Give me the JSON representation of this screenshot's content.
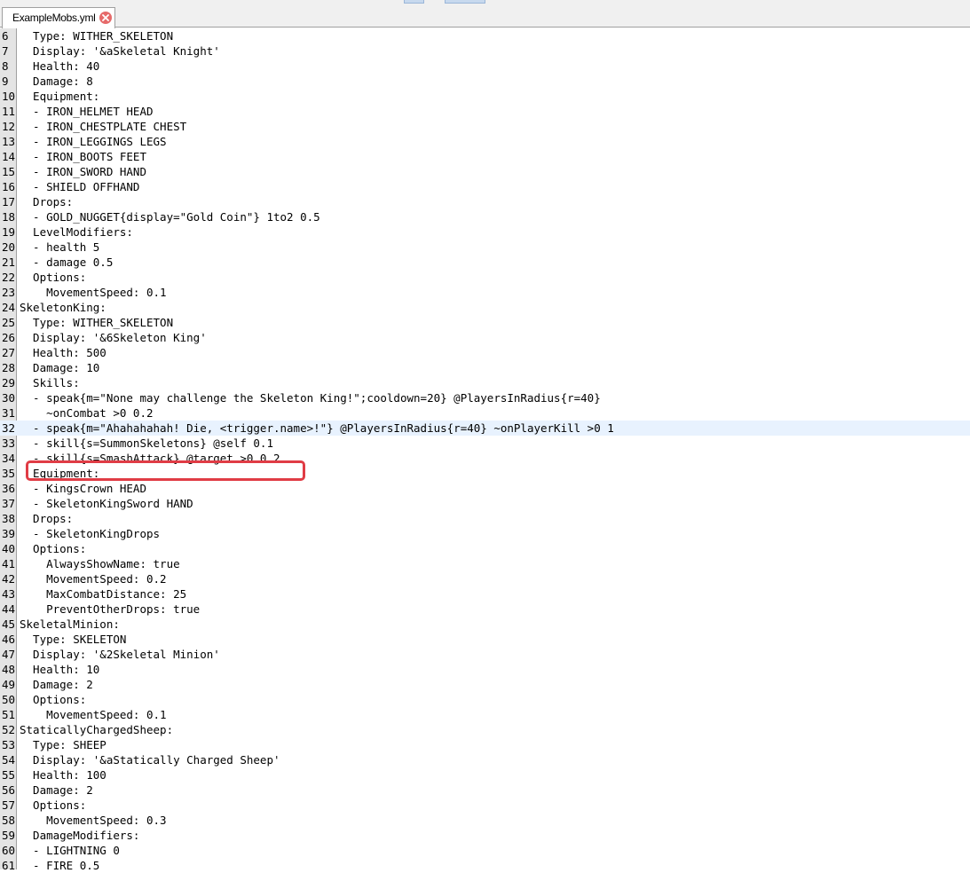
{
  "tab": {
    "title": "ExampleMobs.yml",
    "close_icon": "close-icon"
  },
  "editor": {
    "current_line": 32,
    "lines": [
      {
        "n": "6",
        "t": "  Type: WITHER_SKELETON"
      },
      {
        "n": "7",
        "t": "  Display: '&aSkeletal Knight'"
      },
      {
        "n": "8",
        "t": "  Health: 40"
      },
      {
        "n": "9",
        "t": "  Damage: 8"
      },
      {
        "n": "10",
        "t": "  Equipment:"
      },
      {
        "n": "11",
        "t": "  - IRON_HELMET HEAD"
      },
      {
        "n": "12",
        "t": "  - IRON_CHESTPLATE CHEST"
      },
      {
        "n": "13",
        "t": "  - IRON_LEGGINGS LEGS"
      },
      {
        "n": "14",
        "t": "  - IRON_BOOTS FEET"
      },
      {
        "n": "15",
        "t": "  - IRON_SWORD HAND"
      },
      {
        "n": "16",
        "t": "  - SHIELD OFFHAND"
      },
      {
        "n": "17",
        "t": "  Drops:"
      },
      {
        "n": "18",
        "t": "  - GOLD_NUGGET{display=\"Gold Coin\"} 1to2 0.5"
      },
      {
        "n": "19",
        "t": "  LevelModifiers:"
      },
      {
        "n": "20",
        "t": "  - health 5"
      },
      {
        "n": "21",
        "t": "  - damage 0.5"
      },
      {
        "n": "22",
        "t": "  Options:"
      },
      {
        "n": "23",
        "t": "    MovementSpeed: 0.1"
      },
      {
        "n": "24",
        "t": "SkeletonKing:"
      },
      {
        "n": "25",
        "t": "  Type: WITHER_SKELETON"
      },
      {
        "n": "26",
        "t": "  Display: '&6Skeleton King'"
      },
      {
        "n": "27",
        "t": "  Health: 500"
      },
      {
        "n": "28",
        "t": "  Damage: 10"
      },
      {
        "n": "29",
        "t": "  Skills:"
      },
      {
        "n": "30",
        "t": "  - speak{m=\"None may challenge the Skeleton King!\";cooldown=20} @PlayersInRadius{r=40}"
      },
      {
        "n": "31",
        "t": "    ~onCombat >0 0.2"
      },
      {
        "n": "32",
        "t": "  - speak{m=\"Ahahahahah! Die, <trigger.name>!\"} @PlayersInRadius{r=40} ~onPlayerKill >0 1"
      },
      {
        "n": "33",
        "t": "  - skill{s=SummonSkeletons} @self 0.1"
      },
      {
        "n": "34",
        "t": "  - skill{s=SmashAttack} @target >0 0.2"
      },
      {
        "n": "35",
        "t": "  Equipment:"
      },
      {
        "n": "36",
        "t": "  - KingsCrown HEAD"
      },
      {
        "n": "37",
        "t": "  - SkeletonKingSword HAND"
      },
      {
        "n": "38",
        "t": "  Drops:"
      },
      {
        "n": "39",
        "t": "  - SkeletonKingDrops"
      },
      {
        "n": "40",
        "t": "  Options:"
      },
      {
        "n": "41",
        "t": "    AlwaysShowName: true"
      },
      {
        "n": "42",
        "t": "    MovementSpeed: 0.2"
      },
      {
        "n": "43",
        "t": "    MaxCombatDistance: 25"
      },
      {
        "n": "44",
        "t": "    PreventOtherDrops: true"
      },
      {
        "n": "45",
        "t": "SkeletalMinion:"
      },
      {
        "n": "46",
        "t": "  Type: SKELETON"
      },
      {
        "n": "47",
        "t": "  Display: '&2Skeletal Minion'"
      },
      {
        "n": "48",
        "t": "  Health: 10"
      },
      {
        "n": "49",
        "t": "  Damage: 2"
      },
      {
        "n": "50",
        "t": "  Options:"
      },
      {
        "n": "51",
        "t": "    MovementSpeed: 0.1"
      },
      {
        "n": "52",
        "t": "StaticallyChargedSheep:"
      },
      {
        "n": "53",
        "t": "  Type: SHEEP"
      },
      {
        "n": "54",
        "t": "  Display: '&aStatically Charged Sheep'"
      },
      {
        "n": "55",
        "t": "  Health: 100"
      },
      {
        "n": "56",
        "t": "  Damage: 2"
      },
      {
        "n": "57",
        "t": "  Options:"
      },
      {
        "n": "58",
        "t": "    MovementSpeed: 0.3"
      },
      {
        "n": "59",
        "t": "  DamageModifiers:"
      },
      {
        "n": "60",
        "t": "  - LIGHTNING 0"
      },
      {
        "n": "61",
        "t": "  - FIRE 0.5"
      }
    ]
  },
  "colors": {
    "highlight_box": "#e03c45",
    "current_line_bg": "#e8f2fe",
    "gutter_bg": "#e4e4e4",
    "tab_close": "#e66a6a"
  }
}
